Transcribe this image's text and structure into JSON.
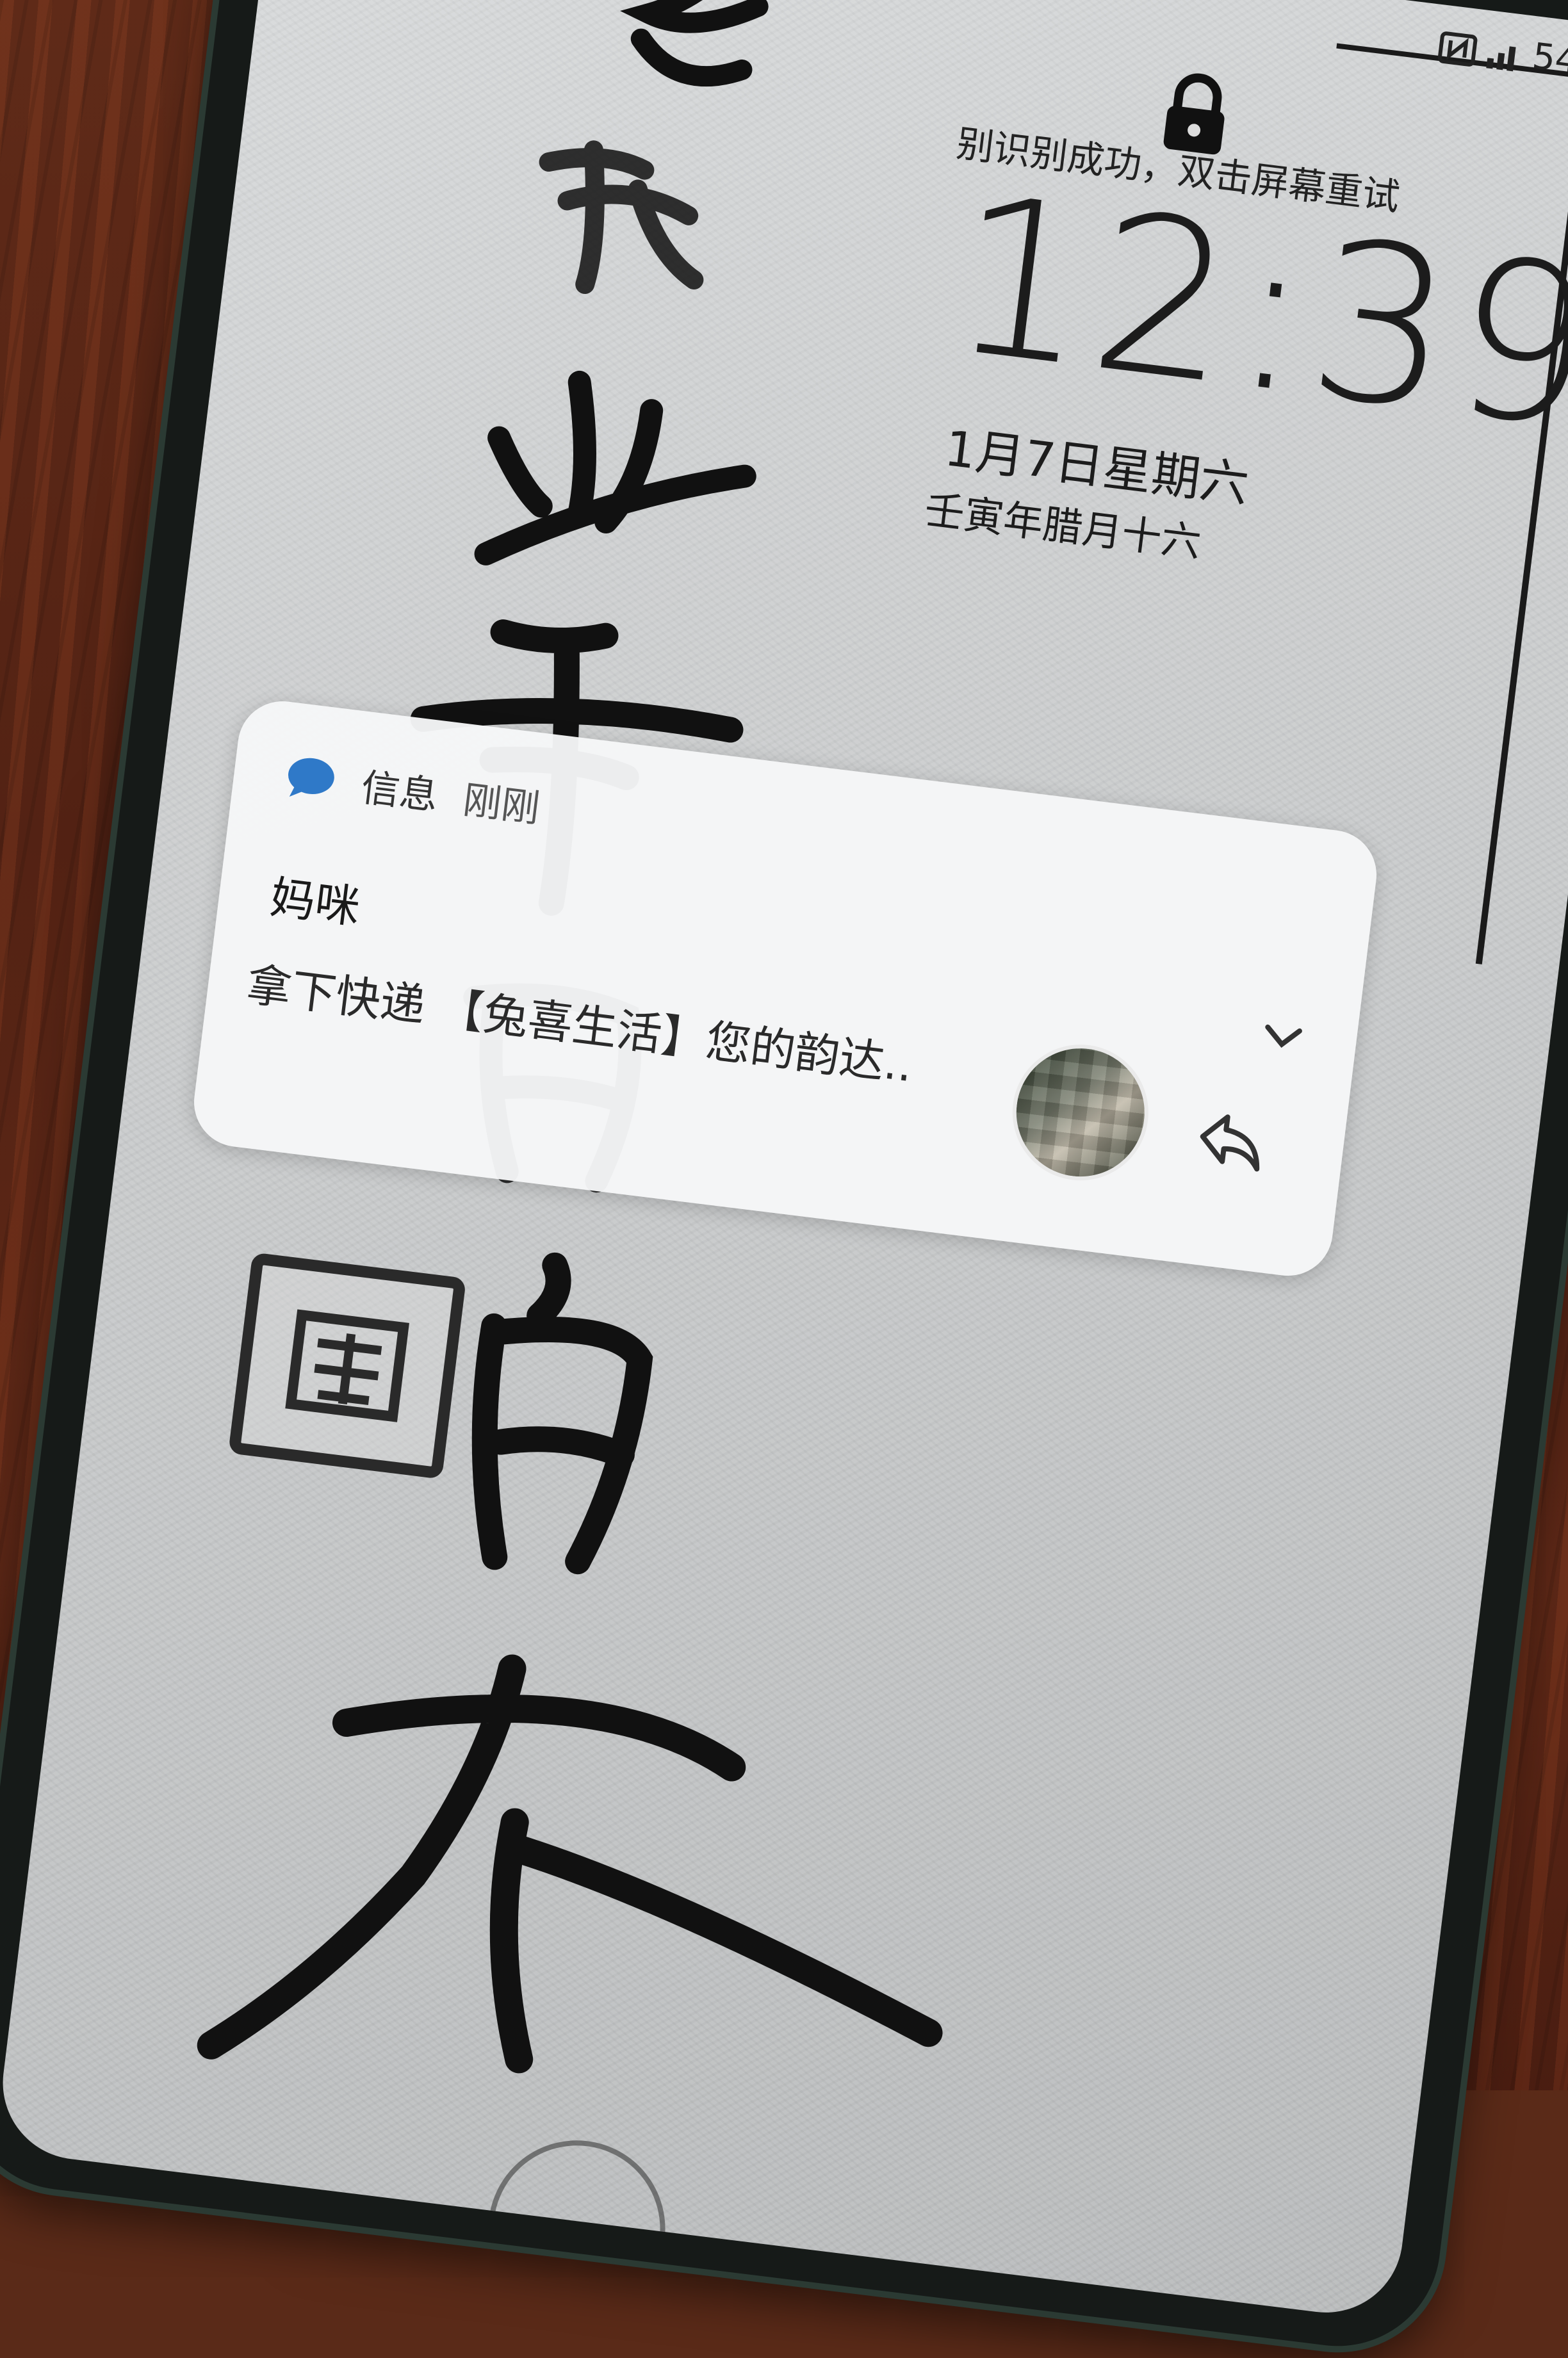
{
  "status_bar": {
    "battery": "54%"
  },
  "lock_screen": {
    "hint": "别识别成功，双击屏幕重试",
    "time": "12:39",
    "date": "1月7日星期六",
    "lunar_date": "壬寅年腊月十六"
  },
  "notification": {
    "app_name": "信息",
    "time": "刚刚",
    "sender": "妈咪",
    "preview": "拿下快递 【兔喜生活】您的韵达.."
  }
}
